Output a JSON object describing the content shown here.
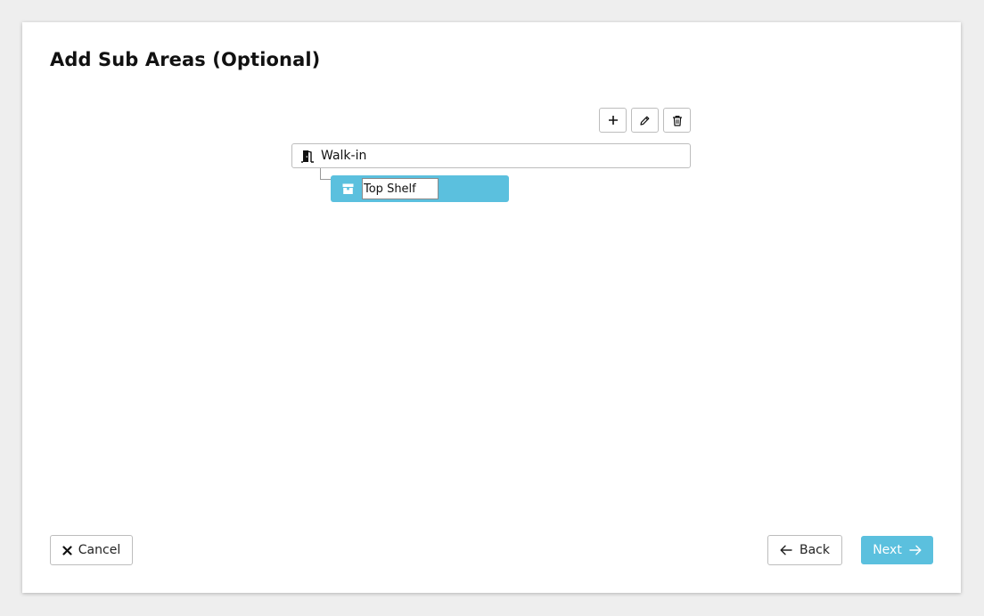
{
  "page": {
    "title": "Add Sub Areas (Optional)"
  },
  "toolbar": {
    "add_icon": "plus-icon",
    "edit_icon": "pencil-icon",
    "delete_icon": "trash-icon"
  },
  "tree": {
    "root": {
      "label": "Walk-in",
      "icon": "door-icon"
    },
    "child": {
      "value": "Top Shelf",
      "icon": "box-icon",
      "selected": true
    }
  },
  "footer": {
    "cancel_label": "Cancel",
    "back_label": "Back",
    "next_label": "Next"
  },
  "colors": {
    "accent": "#5bc0de",
    "border": "#bdbdbd",
    "text": "#111111"
  }
}
